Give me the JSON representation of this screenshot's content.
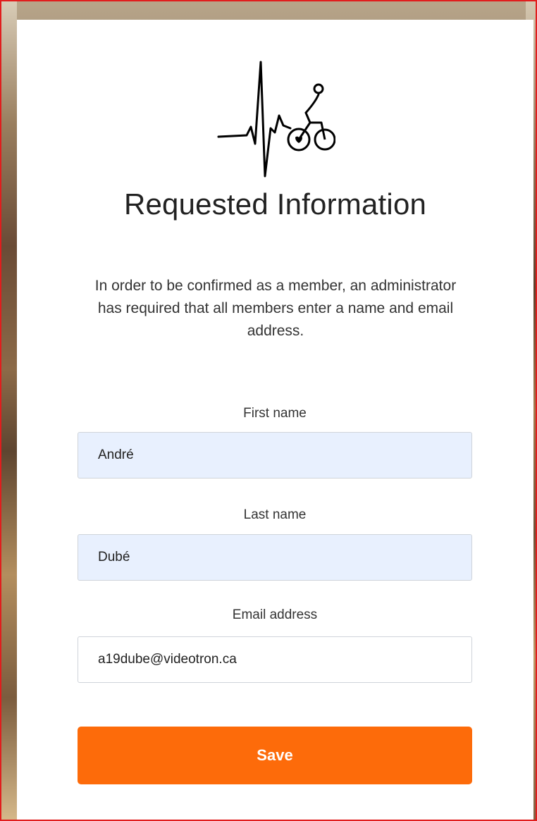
{
  "logo": {
    "name": "heartbeat-cyclist-logo"
  },
  "page": {
    "title": "Requested Information"
  },
  "intro": {
    "text": "In order to be confirmed as a member, an administrator has required that all members enter a name and email address."
  },
  "form": {
    "first_name": {
      "label": "First name",
      "value": "André"
    },
    "last_name": {
      "label": "Last name",
      "value": "Dubé"
    },
    "email": {
      "label": "Email address",
      "value": "a19dube@videotron.ca"
    },
    "save_label": "Save"
  },
  "colors": {
    "accent": "#fd6b0a",
    "autofill": "#e8f0fe",
    "frame_border": "#e11d1d"
  }
}
